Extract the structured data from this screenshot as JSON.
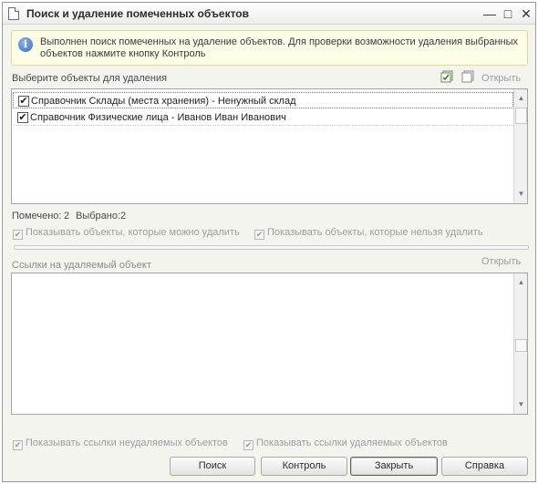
{
  "window": {
    "title": "Поиск и удаление помеченных объектов",
    "minimize": "—",
    "maximize": "□",
    "close": "✕"
  },
  "info": {
    "icon": "info-icon",
    "text": "Выполнен поиск помеченных на удаление объектов. Для проверки возможности удаления выбранных объектов нажмите кнопку Контроль"
  },
  "objects": {
    "label": "Выберите объекты для удаления",
    "open_link": "Открыть",
    "items": [
      {
        "checked": true,
        "text": "Справочник Склады (места хранения) - Ненужный склад"
      },
      {
        "checked": true,
        "text": "Справочник Физические лица - Иванов Иван Иванович"
      }
    ],
    "marked_label": "Помечено:",
    "marked_count": "2",
    "selected_label": "Выбрано:",
    "selected_count": "2",
    "show_deletable": "Показывать объекты, которые можно удалить",
    "show_non_deletable": "Показывать объекты, которые нельзя удалить"
  },
  "refs": {
    "label": "Ссылки на удаляемый объект",
    "open_link": "Открыть",
    "show_non_deletable_refs": "Показывать ссылки неудаляемых объектов",
    "show_deletable_refs": "Показывать ссылки удаляемых объектов"
  },
  "buttons": {
    "search": "Поиск",
    "control": "Контроль",
    "close": "Закрыть",
    "help": "Справка"
  },
  "checkmark": "✔"
}
